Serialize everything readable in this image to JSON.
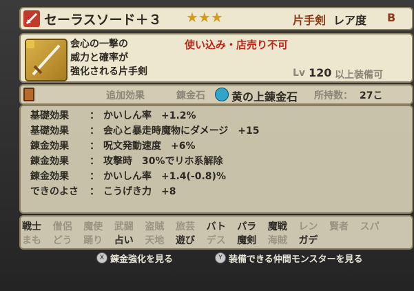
{
  "header": {
    "item_name": "セーラスソード＋３",
    "stars": "★★★",
    "category": "片手剣",
    "rarity_label": "レア度",
    "rarity_value": "B"
  },
  "description": {
    "lines": [
      "会心の一撃の",
      "威力と確率が",
      "強化される片手剣"
    ],
    "warning": "使い込み・店売り不可",
    "level_prefix": "Lv",
    "level_value": "120",
    "level_suffix": "以上装備可"
  },
  "alchemy": {
    "effect_header": "追加効果",
    "stone_label": "錬金石",
    "stone_name": "黄の上錬金石",
    "owned_label": "所持数：",
    "owned_value": "27こ"
  },
  "effects": [
    {
      "type": "基礎効果",
      "sep": "：",
      "value": "かいしん率　+1.2%"
    },
    {
      "type": "基礎効果",
      "sep": "：",
      "value": "会心と暴走時魔物にダメージ　+15"
    },
    {
      "type": "錬金効果",
      "sep": "：",
      "value": "呪文発動速度　+6%"
    },
    {
      "type": "錬金効果",
      "sep": "：",
      "value": "攻撃時　30%でリホ系解除"
    },
    {
      "type": "錬金効果",
      "sep": "：",
      "value": "かいしん率　+1.4(-0.8)%"
    },
    {
      "type": "できのよさ",
      "sep": "：",
      "value": "こうげき力　+8"
    }
  ],
  "vocations_row1": [
    {
      "label": "戦士",
      "on": true
    },
    {
      "label": "僧侶",
      "on": false
    },
    {
      "label": "魔使",
      "on": false
    },
    {
      "label": "武闘",
      "on": false
    },
    {
      "label": "盗賊",
      "on": false
    },
    {
      "label": "旅芸",
      "on": false
    },
    {
      "label": "バト",
      "on": true
    },
    {
      "label": "パラ",
      "on": true
    },
    {
      "label": "魔戦",
      "on": true
    },
    {
      "label": "レン",
      "on": false
    },
    {
      "label": "賢者",
      "on": false
    },
    {
      "label": "スパ",
      "on": false
    }
  ],
  "vocations_row2": [
    {
      "label": "まも",
      "on": false
    },
    {
      "label": "どう",
      "on": false
    },
    {
      "label": "踊り",
      "on": false
    },
    {
      "label": "占い",
      "on": true
    },
    {
      "label": "天地",
      "on": false
    },
    {
      "label": "遊び",
      "on": true
    },
    {
      "label": "デス",
      "on": false
    },
    {
      "label": "魔剣",
      "on": true
    },
    {
      "label": "海賊",
      "on": false
    },
    {
      "label": "ガデ",
      "on": true
    }
  ],
  "footer": {
    "x_button": "X",
    "x_action": "錬金強化を見る",
    "y_button": "Y",
    "y_action": "装備できる仲間モンスターを見る"
  },
  "colors": {
    "accent_red": "#c0251a",
    "text_dark": "#2c2a22",
    "star_gold": "#d89a1c"
  },
  "icons": [
    "one-hand-sword-icon",
    "lock-icon",
    "book-icon",
    "alchemy-stone-icon"
  ]
}
